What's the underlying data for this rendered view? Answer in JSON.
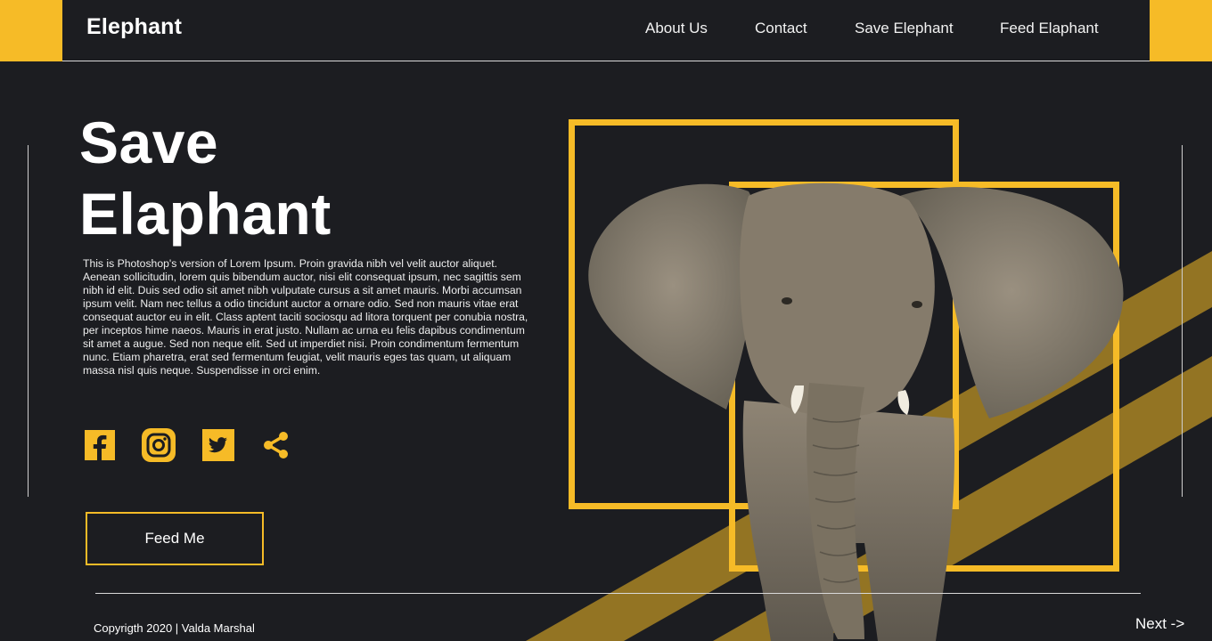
{
  "header": {
    "brand": "Elephant",
    "nav": [
      "About Us",
      "Contact",
      "Save Elephant",
      "Feed Elaphant"
    ]
  },
  "hero": {
    "title_line1": "Save",
    "title_line2": "Elaphant",
    "body": "This is Photoshop's version  of Lorem Ipsum. Proin gravida nibh vel velit auctor aliquet. Aenean sollicitudin, lorem quis bibendum auctor, nisi elit consequat ipsum, nec sagittis sem nibh id elit. Duis sed odio sit amet nibh vulputate cursus a sit amet mauris. Morbi accumsan ipsum velit. Nam nec tellus a odio tincidunt auctor a ornare odio. Sed non  mauris vitae erat consequat auctor eu in elit. Class aptent taciti sociosqu ad litora torquent per conubia nostra, per inceptos hime naeos. Mauris in erat justo. Nullam ac urna eu felis dapibus condimentum sit amet a augue. Sed non neque elit. Sed ut imperdiet nisi. Proin condimentum fermentum nunc. Etiam pharetra, erat sed fermentum feugiat, velit mauris eges tas quam, ut aliquam massa nisl quis neque. Suspendisse in orci enim.",
    "cta_label": "Feed Me"
  },
  "social_icons": [
    "facebook-icon",
    "instagram-icon",
    "twitter-icon",
    "share-icon"
  ],
  "footer": {
    "copyright": "Copyrigth 2020  |  Valda Marshal",
    "next_label": "Next  ->"
  },
  "colors": {
    "accent": "#f6bb27",
    "background": "#1c1d21",
    "text": "#ffffff"
  }
}
